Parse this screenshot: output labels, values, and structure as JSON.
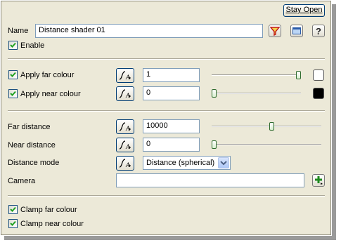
{
  "header": {
    "stay_open_label": "Stay Open"
  },
  "name": {
    "label": "Name",
    "value": "Distance shader 01"
  },
  "enable": {
    "label": "Enable",
    "checked": true
  },
  "apply_far": {
    "label": "Apply far colour",
    "checked": true,
    "value": "1",
    "slider_fraction": 1.0,
    "swatch_color": "#ffffff"
  },
  "apply_near": {
    "label": "Apply near colour",
    "checked": true,
    "value": "0",
    "slider_fraction": 0.0,
    "swatch_color": "#000000"
  },
  "far_distance": {
    "label": "Far distance",
    "value": "10000",
    "slider_fraction": 0.55
  },
  "near_distance": {
    "label": "Near distance",
    "value": "0",
    "slider_fraction": 0.0
  },
  "distance_mode": {
    "label": "Distance mode",
    "selected": "Distance (spherical)"
  },
  "camera": {
    "label": "Camera",
    "value": ""
  },
  "clamp_far": {
    "label": "Clamp far colour",
    "checked": true
  },
  "clamp_near": {
    "label": "Clamp near colour",
    "checked": true
  },
  "icons": [
    "filter-icon",
    "window-icon",
    "help-icon",
    "function-curve-icon",
    "add-icon",
    "chevron-down-icon"
  ],
  "colors": {
    "panel_bg": "#ece9d8",
    "accent": "#003c74",
    "check": "#21a121"
  }
}
